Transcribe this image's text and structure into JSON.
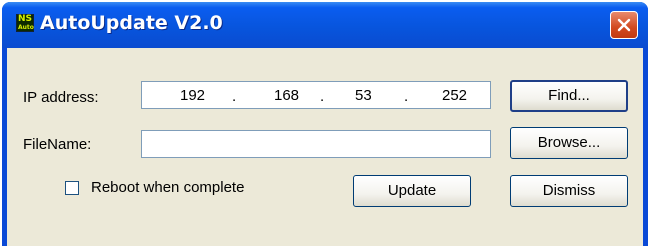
{
  "window": {
    "title": "AutoUpdate V2.0",
    "icon_text_top": "NS",
    "icon_text_bottom": "Auto"
  },
  "form": {
    "ip_label": "IP address:",
    "ip_octets": [
      "192",
      "168",
      "53",
      "252"
    ],
    "ip_separator": ".",
    "filename_label": "FileName:",
    "filename_value": "",
    "reboot_label": "Reboot when complete",
    "reboot_checked": false
  },
  "buttons": {
    "find": "Find...",
    "browse": "Browse...",
    "update": "Update",
    "dismiss": "Dismiss"
  },
  "icons": {
    "close": "close-icon",
    "app": "app-icon"
  },
  "colors": {
    "titlebar": "#0a4bd0",
    "close_button": "#d24a20",
    "dialog_background": "#ece9d8"
  }
}
